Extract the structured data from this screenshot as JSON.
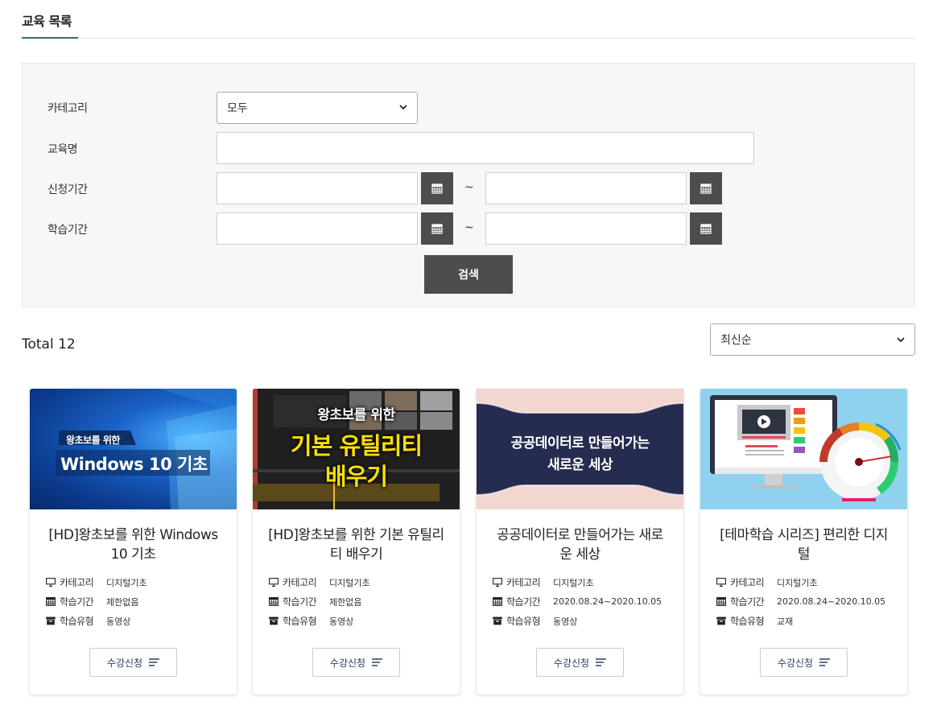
{
  "header": {
    "title": "교육 목록"
  },
  "filters": {
    "category_label": "카테고리",
    "category_value": "모두",
    "name_label": "교육명",
    "name_value": "",
    "apply_period_label": "신청기간",
    "study_period_label": "학습기간",
    "range_separator": "~",
    "search_label": "검색"
  },
  "results": {
    "total_text": "Total 12",
    "sort_value": "최신순"
  },
  "meta_labels": {
    "category": "카테고리",
    "period": "학습기간",
    "type": "학습유형"
  },
  "courses": [
    {
      "thumb_kind": "windows",
      "thumb_small": "왕초보를 위한",
      "thumb_big": "Windows 10 기초",
      "title": "[HD]왕초보를 위한 Windows 10 기초",
      "category": "디지털기초",
      "period": "제한없음",
      "type": "동영상",
      "enroll": "수강신청"
    },
    {
      "thumb_kind": "utility",
      "thumb_small": "왕초보를 위한",
      "thumb_big1": "기본 유틸리티",
      "thumb_big2": "배우기",
      "title": "[HD]왕초보를 위한 기본 유틸리티 배우기",
      "category": "디지털기초",
      "period": "제한없음",
      "type": "동영상",
      "enroll": "수강신청"
    },
    {
      "thumb_kind": "public",
      "thumb_line1": "공공데이터로 만들어가는",
      "thumb_line2": "새로운 세상",
      "title": "공공데이터로 만들어가는 새로운 세상",
      "category": "디지털기초",
      "period": "2020.08.24~2020.10.05",
      "type": "동영상",
      "enroll": "수강신청"
    },
    {
      "thumb_kind": "digital",
      "title": "[테마학습 시리즈] 편리한 디지털",
      "category": "디지털기초",
      "period": "2020.08.24~2020.10.05",
      "type": "교재",
      "enroll": "수강신청"
    }
  ],
  "colors": {
    "dark_button": "#4d4d4d",
    "accent_underline": "#3a6b73"
  },
  "icons": [
    "calendar-icon",
    "monitor-icon",
    "archive-icon",
    "list-icon",
    "chevron-down-icon"
  ]
}
